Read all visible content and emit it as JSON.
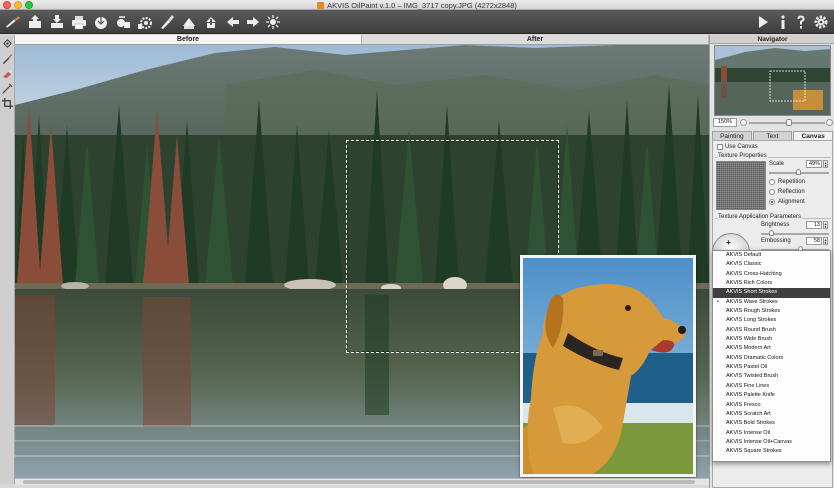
{
  "window": {
    "title": "AKVIS OilPaint v.1.0 – IMG_3717 copy.JPG (4272x2848)"
  },
  "toolbar": {
    "left_buttons": [
      {
        "name": "brush-logo-icon"
      },
      {
        "name": "open-icon"
      },
      {
        "name": "save-icon"
      },
      {
        "name": "print-icon"
      },
      {
        "name": "share-icon"
      },
      {
        "name": "batch-process-icon"
      },
      {
        "name": "batch-settings-icon"
      },
      {
        "name": "brush-tool-icon"
      },
      {
        "name": "apply-icon"
      },
      {
        "name": "export-icon"
      },
      {
        "name": "undo-icon"
      },
      {
        "name": "redo-icon"
      },
      {
        "name": "settings-star-icon"
      }
    ],
    "right_buttons": [
      {
        "name": "run-icon"
      },
      {
        "name": "info-icon"
      },
      {
        "name": "help-icon"
      },
      {
        "name": "preferences-gear-icon"
      }
    ]
  },
  "view_tabs": {
    "before": "Before",
    "after": "After",
    "active": "before"
  },
  "navigator": {
    "title": "Navigator",
    "zoom": "150%"
  },
  "panel_tabs": {
    "painting": "Painting",
    "text": "Text",
    "canvas": "Canvas",
    "active": "canvas"
  },
  "canvas_settings": {
    "use_canvas_label": "Use Canvas",
    "texture_properties_label": "Texture Properties",
    "scale_label": "Scale",
    "scale_value": "49%",
    "scale_fraction": 0.49,
    "repetition_label": "Repetition",
    "reflection_label": "Reflection",
    "alignment_label": "Alignment",
    "selected_mode": "alignment",
    "texture_params_label": "Texture Application Parameters",
    "brightness_label": "Brightness",
    "brightness_value": "13",
    "brightness_fraction": 0.13,
    "embossing_label": "Embossing",
    "embossing_value": "58",
    "embossing_fraction": 0.58
  },
  "presets": {
    "items": [
      "AKVIS Default",
      "AKVIS Classic",
      "AKVIS Cross-Hatching",
      "AKVIS Rich Colors",
      "AKVIS Short Strokes",
      "AKVIS Wave Strokes",
      "AKVIS Rough Strokes",
      "AKVIS Long Strokes",
      "AKVIS Round Brush",
      "AKVIS Wide Brush",
      "AKVIS Modern Art",
      "AKVIS Dramatic Colors",
      "AKVIS Pastel Oil",
      "AKVIS Twisted Brush",
      "AKVIS Fine Lines",
      "AKVIS Palette Knife",
      "AKVIS Fresco",
      "AKVIS Scratch Art",
      "AKVIS Bold Strokes",
      "AKVIS Intense Oil",
      "AKVIS Intense Oil+Canvas",
      "AKVIS Square Strokes"
    ],
    "selected_index": 4,
    "marked_index": 5
  },
  "colors": {
    "toolbar": "#4a4a4a",
    "panel": "#e3e3e3",
    "selected_preset": "#3f3f3f"
  }
}
